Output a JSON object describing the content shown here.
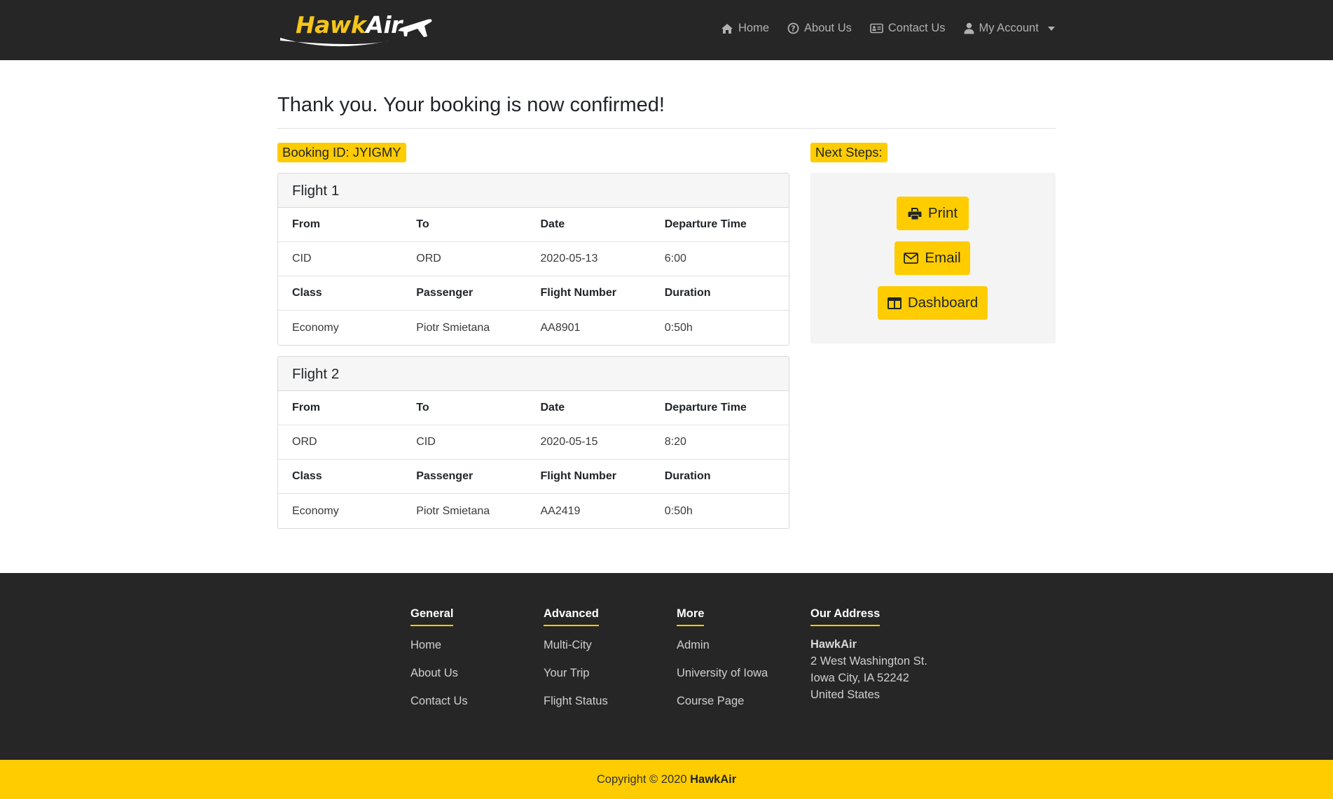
{
  "brand": {
    "part1": "Hawk",
    "part2": "Air"
  },
  "nav": {
    "home": "Home",
    "about": "About Us",
    "contact": "Contact Us",
    "account": "My Account"
  },
  "page_title": "Thank you. Your booking is now confirmed!",
  "booking_id": "Booking ID: JYIGMY",
  "next_steps": "Next Steps:",
  "flights": [
    {
      "title": "Flight 1",
      "labels1": [
        "From",
        "To",
        "Date",
        "Departure Time"
      ],
      "values1": [
        "CID",
        "ORD",
        "2020-05-13",
        "6:00"
      ],
      "labels2": [
        "Class",
        "Passenger",
        "Flight Number",
        "Duration"
      ],
      "values2": [
        "Economy",
        "Piotr Smietana",
        "AA8901",
        "0:50h"
      ]
    },
    {
      "title": "Flight 2",
      "labels1": [
        "From",
        "To",
        "Date",
        "Departure Time"
      ],
      "values1": [
        "ORD",
        "CID",
        "2020-05-15",
        "8:20"
      ],
      "labels2": [
        "Class",
        "Passenger",
        "Flight Number",
        "Duration"
      ],
      "values2": [
        "Economy",
        "Piotr Smietana",
        "AA2419",
        "0:50h"
      ]
    }
  ],
  "buttons": {
    "print": "Print",
    "email": "Email",
    "dashboard": "Dashboard"
  },
  "footer": {
    "general": {
      "title": "General",
      "links": [
        "Home",
        "About Us",
        "Contact Us"
      ]
    },
    "advanced": {
      "title": "Advanced",
      "links": [
        "Multi-City",
        "Your Trip",
        "Flight Status"
      ]
    },
    "more": {
      "title": "More",
      "links": [
        "Admin",
        "University of Iowa",
        "Course Page"
      ]
    },
    "address": {
      "title": "Our Address",
      "name": "HawkAir",
      "line1": "2 West Washington St.",
      "line2": "Iowa City, IA 52242",
      "line3": "United States"
    }
  },
  "copyright": {
    "text": "Copyright © 2020",
    "brand": "HawkAir"
  },
  "colors": {
    "accent": "#ffcc00",
    "dark": "#262626"
  }
}
